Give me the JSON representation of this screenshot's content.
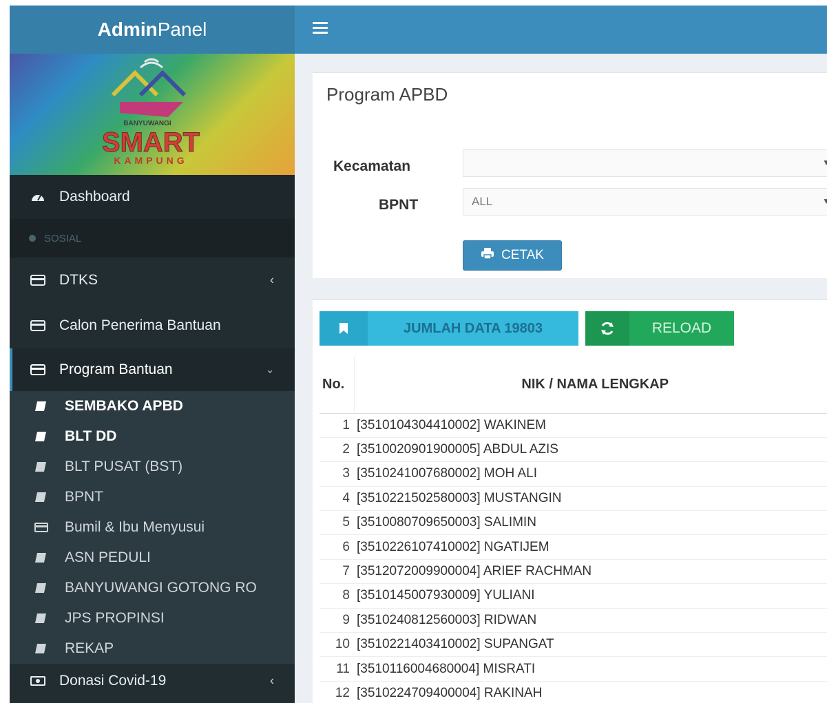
{
  "app": {
    "logo_bold": "Admin",
    "logo_light": "Panel",
    "brand_title": "SMART",
    "brand_top": "BANYUWANGI",
    "brand_bottom": "KAMPUNG"
  },
  "sidebar": {
    "dashboard": "Dashboard",
    "section_header": "SOSIAL",
    "dtks": "DTKS",
    "calon": "Calon Penerima Bantuan",
    "program": "Program Bantuan",
    "submenu": [
      "SEMBAKO APBD",
      "BLT DD",
      "BLT PUSAT (BST)",
      "BPNT",
      "Bumil & Ibu Menyusui",
      "ASN PEDULI",
      "BANYUWANGI GOTONG RO",
      "JPS PROPINSI",
      "REKAP"
    ],
    "donasi": "Donasi Covid-19"
  },
  "filter": {
    "title": "Program APBD",
    "kecamatan_label": "Kecamatan",
    "kecamatan_value": "",
    "bpnt_label": "BPNT",
    "bpnt_value": "ALL",
    "cetak_label": "CETAK"
  },
  "actions": {
    "jumlah_label": "JUMLAH DATA 19803",
    "reload_label": "RELOAD"
  },
  "table": {
    "headers": [
      "No.",
      "NIK / NAMA LENGKAP"
    ],
    "rows": [
      {
        "no": "1",
        "entry": "[3510104304410002] WAKINEM"
      },
      {
        "no": "2",
        "entry": "[3510020901900005] ABDUL AZIS"
      },
      {
        "no": "3",
        "entry": "[3510241007680002] MOH ALI"
      },
      {
        "no": "4",
        "entry": "[3510221502580003] MUSTANGIN"
      },
      {
        "no": "5",
        "entry": "[3510080709650003] SALIMIN"
      },
      {
        "no": "6",
        "entry": "[3510226107410002] NGATIJEM"
      },
      {
        "no": "7",
        "entry": "[3512072009900004] ARIEF RACHMAN"
      },
      {
        "no": "8",
        "entry": "[3510145007930009] YULIANI"
      },
      {
        "no": "9",
        "entry": "[3510240812560003] RIDWAN"
      },
      {
        "no": "10",
        "entry": "[3510221403410002] SUPANGAT"
      },
      {
        "no": "11",
        "entry": "[3510116004680004] MISRATI"
      },
      {
        "no": "12",
        "entry": "[3510224709400004] RAKINAH"
      }
    ]
  },
  "colors": {
    "sidebar": "#222d32",
    "header": "#3c8dbc",
    "info": "#35b9dc",
    "success": "#22a85a"
  }
}
